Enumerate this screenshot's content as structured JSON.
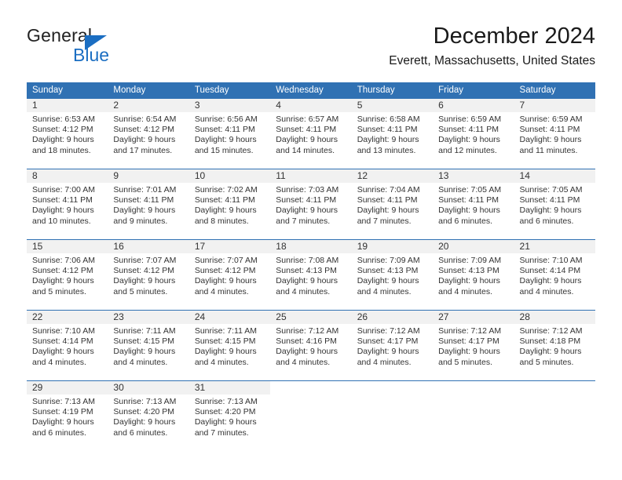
{
  "brand": {
    "name_part1": "General",
    "name_part2": "Blue",
    "accent_color": "#1b6ec2"
  },
  "header": {
    "title": "December 2024",
    "subtitle": "Everett, Massachusetts, United States"
  },
  "calendar": {
    "header_color": "#3071b3",
    "weekdays": [
      "Sunday",
      "Monday",
      "Tuesday",
      "Wednesday",
      "Thursday",
      "Friday",
      "Saturday"
    ],
    "weeks": [
      [
        {
          "day": "1",
          "sunrise": "Sunrise: 6:53 AM",
          "sunset": "Sunset: 4:12 PM",
          "daylight1": "Daylight: 9 hours",
          "daylight2": "and 18 minutes."
        },
        {
          "day": "2",
          "sunrise": "Sunrise: 6:54 AM",
          "sunset": "Sunset: 4:12 PM",
          "daylight1": "Daylight: 9 hours",
          "daylight2": "and 17 minutes."
        },
        {
          "day": "3",
          "sunrise": "Sunrise: 6:56 AM",
          "sunset": "Sunset: 4:11 PM",
          "daylight1": "Daylight: 9 hours",
          "daylight2": "and 15 minutes."
        },
        {
          "day": "4",
          "sunrise": "Sunrise: 6:57 AM",
          "sunset": "Sunset: 4:11 PM",
          "daylight1": "Daylight: 9 hours",
          "daylight2": "and 14 minutes."
        },
        {
          "day": "5",
          "sunrise": "Sunrise: 6:58 AM",
          "sunset": "Sunset: 4:11 PM",
          "daylight1": "Daylight: 9 hours",
          "daylight2": "and 13 minutes."
        },
        {
          "day": "6",
          "sunrise": "Sunrise: 6:59 AM",
          "sunset": "Sunset: 4:11 PM",
          "daylight1": "Daylight: 9 hours",
          "daylight2": "and 12 minutes."
        },
        {
          "day": "7",
          "sunrise": "Sunrise: 6:59 AM",
          "sunset": "Sunset: 4:11 PM",
          "daylight1": "Daylight: 9 hours",
          "daylight2": "and 11 minutes."
        }
      ],
      [
        {
          "day": "8",
          "sunrise": "Sunrise: 7:00 AM",
          "sunset": "Sunset: 4:11 PM",
          "daylight1": "Daylight: 9 hours",
          "daylight2": "and 10 minutes."
        },
        {
          "day": "9",
          "sunrise": "Sunrise: 7:01 AM",
          "sunset": "Sunset: 4:11 PM",
          "daylight1": "Daylight: 9 hours",
          "daylight2": "and 9 minutes."
        },
        {
          "day": "10",
          "sunrise": "Sunrise: 7:02 AM",
          "sunset": "Sunset: 4:11 PM",
          "daylight1": "Daylight: 9 hours",
          "daylight2": "and 8 minutes."
        },
        {
          "day": "11",
          "sunrise": "Sunrise: 7:03 AM",
          "sunset": "Sunset: 4:11 PM",
          "daylight1": "Daylight: 9 hours",
          "daylight2": "and 7 minutes."
        },
        {
          "day": "12",
          "sunrise": "Sunrise: 7:04 AM",
          "sunset": "Sunset: 4:11 PM",
          "daylight1": "Daylight: 9 hours",
          "daylight2": "and 7 minutes."
        },
        {
          "day": "13",
          "sunrise": "Sunrise: 7:05 AM",
          "sunset": "Sunset: 4:11 PM",
          "daylight1": "Daylight: 9 hours",
          "daylight2": "and 6 minutes."
        },
        {
          "day": "14",
          "sunrise": "Sunrise: 7:05 AM",
          "sunset": "Sunset: 4:11 PM",
          "daylight1": "Daylight: 9 hours",
          "daylight2": "and 6 minutes."
        }
      ],
      [
        {
          "day": "15",
          "sunrise": "Sunrise: 7:06 AM",
          "sunset": "Sunset: 4:12 PM",
          "daylight1": "Daylight: 9 hours",
          "daylight2": "and 5 minutes."
        },
        {
          "day": "16",
          "sunrise": "Sunrise: 7:07 AM",
          "sunset": "Sunset: 4:12 PM",
          "daylight1": "Daylight: 9 hours",
          "daylight2": "and 5 minutes."
        },
        {
          "day": "17",
          "sunrise": "Sunrise: 7:07 AM",
          "sunset": "Sunset: 4:12 PM",
          "daylight1": "Daylight: 9 hours",
          "daylight2": "and 4 minutes."
        },
        {
          "day": "18",
          "sunrise": "Sunrise: 7:08 AM",
          "sunset": "Sunset: 4:13 PM",
          "daylight1": "Daylight: 9 hours",
          "daylight2": "and 4 minutes."
        },
        {
          "day": "19",
          "sunrise": "Sunrise: 7:09 AM",
          "sunset": "Sunset: 4:13 PM",
          "daylight1": "Daylight: 9 hours",
          "daylight2": "and 4 minutes."
        },
        {
          "day": "20",
          "sunrise": "Sunrise: 7:09 AM",
          "sunset": "Sunset: 4:13 PM",
          "daylight1": "Daylight: 9 hours",
          "daylight2": "and 4 minutes."
        },
        {
          "day": "21",
          "sunrise": "Sunrise: 7:10 AM",
          "sunset": "Sunset: 4:14 PM",
          "daylight1": "Daylight: 9 hours",
          "daylight2": "and 4 minutes."
        }
      ],
      [
        {
          "day": "22",
          "sunrise": "Sunrise: 7:10 AM",
          "sunset": "Sunset: 4:14 PM",
          "daylight1": "Daylight: 9 hours",
          "daylight2": "and 4 minutes."
        },
        {
          "day": "23",
          "sunrise": "Sunrise: 7:11 AM",
          "sunset": "Sunset: 4:15 PM",
          "daylight1": "Daylight: 9 hours",
          "daylight2": "and 4 minutes."
        },
        {
          "day": "24",
          "sunrise": "Sunrise: 7:11 AM",
          "sunset": "Sunset: 4:15 PM",
          "daylight1": "Daylight: 9 hours",
          "daylight2": "and 4 minutes."
        },
        {
          "day": "25",
          "sunrise": "Sunrise: 7:12 AM",
          "sunset": "Sunset: 4:16 PM",
          "daylight1": "Daylight: 9 hours",
          "daylight2": "and 4 minutes."
        },
        {
          "day": "26",
          "sunrise": "Sunrise: 7:12 AM",
          "sunset": "Sunset: 4:17 PM",
          "daylight1": "Daylight: 9 hours",
          "daylight2": "and 4 minutes."
        },
        {
          "day": "27",
          "sunrise": "Sunrise: 7:12 AM",
          "sunset": "Sunset: 4:17 PM",
          "daylight1": "Daylight: 9 hours",
          "daylight2": "and 5 minutes."
        },
        {
          "day": "28",
          "sunrise": "Sunrise: 7:12 AM",
          "sunset": "Sunset: 4:18 PM",
          "daylight1": "Daylight: 9 hours",
          "daylight2": "and 5 minutes."
        }
      ],
      [
        {
          "day": "29",
          "sunrise": "Sunrise: 7:13 AM",
          "sunset": "Sunset: 4:19 PM",
          "daylight1": "Daylight: 9 hours",
          "daylight2": "and 6 minutes."
        },
        {
          "day": "30",
          "sunrise": "Sunrise: 7:13 AM",
          "sunset": "Sunset: 4:20 PM",
          "daylight1": "Daylight: 9 hours",
          "daylight2": "and 6 minutes."
        },
        {
          "day": "31",
          "sunrise": "Sunrise: 7:13 AM",
          "sunset": "Sunset: 4:20 PM",
          "daylight1": "Daylight: 9 hours",
          "daylight2": "and 7 minutes."
        },
        {
          "day": "",
          "sunrise": "",
          "sunset": "",
          "daylight1": "",
          "daylight2": ""
        },
        {
          "day": "",
          "sunrise": "",
          "sunset": "",
          "daylight1": "",
          "daylight2": ""
        },
        {
          "day": "",
          "sunrise": "",
          "sunset": "",
          "daylight1": "",
          "daylight2": ""
        },
        {
          "day": "",
          "sunrise": "",
          "sunset": "",
          "daylight1": "",
          "daylight2": ""
        }
      ]
    ]
  }
}
